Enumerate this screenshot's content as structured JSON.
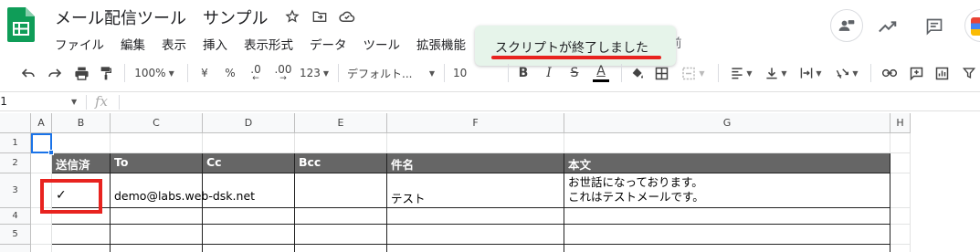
{
  "app": {
    "doc_title": "メール配信ツール　サンプル",
    "brand_color": "#0f9d58"
  },
  "menu": {
    "items": [
      "ファイル",
      "編集",
      "表示",
      "挿入",
      "表示形式",
      "データ",
      "ツール",
      "拡張機能",
      "ヘ"
    ],
    "tail": "前"
  },
  "toast": {
    "message": "スクリプトが終了しました",
    "highlight_color": "#e8231f"
  },
  "toolbar": {
    "zoom": "100%",
    "currency": "¥",
    "percent": "%",
    "decimal_decrease": ".0",
    "decimal_increase": ".00",
    "more_formats": "123",
    "font": "デフォルト...",
    "font_size": "10",
    "bold": "B",
    "italic": "I",
    "strike": "S",
    "text_color": "A"
  },
  "formula_bar": {
    "name_box": "A1",
    "fx": "fx",
    "value": ""
  },
  "sheet": {
    "columns": [
      "A",
      "B",
      "C",
      "D",
      "E",
      "F",
      "G",
      "H"
    ],
    "rows": [
      "1",
      "2",
      "3",
      "4",
      "5"
    ],
    "header_row": {
      "sent": "送信済",
      "to": "To",
      "cc": "Cc",
      "bcc": "Bcc",
      "subject": "件名",
      "body": "本文"
    },
    "data_row": {
      "sent": "✓",
      "to": "demo@labs.web-dsk.net",
      "cc": "",
      "bcc": "",
      "subject": "テスト",
      "body_line1": "お世話になっております。",
      "body_line2": "これはテストメールです。"
    }
  }
}
